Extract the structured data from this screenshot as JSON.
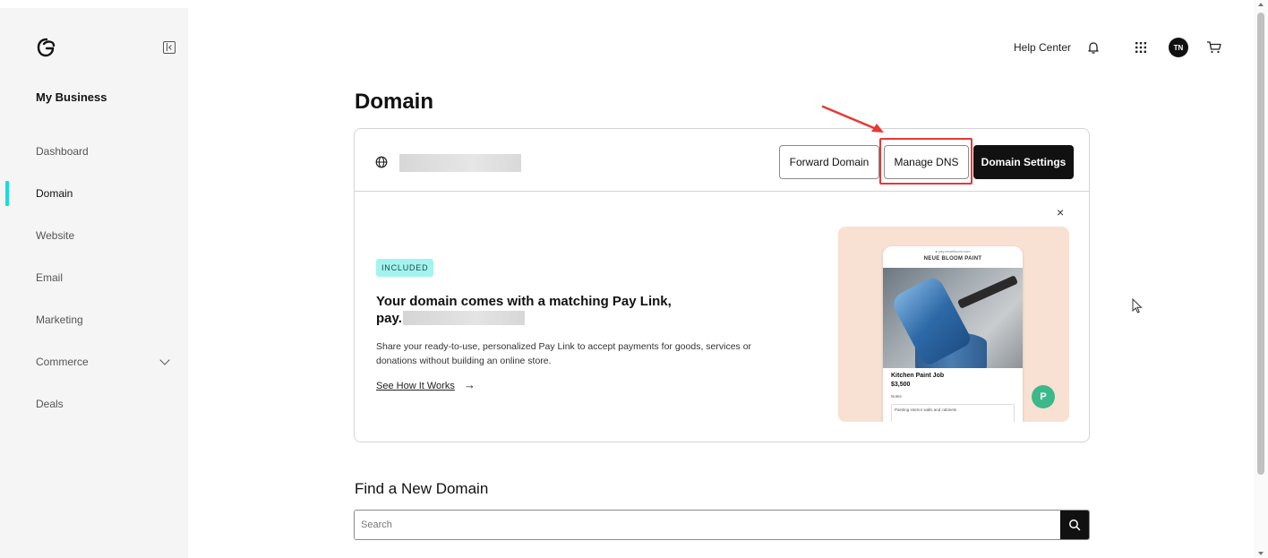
{
  "sidebar": {
    "brand": "My Business",
    "items": [
      {
        "label": "Dashboard"
      },
      {
        "label": "Domain"
      },
      {
        "label": "Website"
      },
      {
        "label": "Email"
      },
      {
        "label": "Marketing"
      },
      {
        "label": "Commerce"
      },
      {
        "label": "Deals"
      }
    ],
    "active_item": "Domain"
  },
  "header": {
    "help_center": "Help Center",
    "avatar_initials": "TN"
  },
  "main": {
    "title": "Domain",
    "domain_card": {
      "buttons": {
        "forward": "Forward Domain",
        "manage_dns": "Manage DNS",
        "settings": "Domain Settings"
      },
      "promo": {
        "badge": "INCLUDED",
        "title": "Your domain comes with a matching Pay Link,",
        "pay_prefix": "pay.",
        "description": "Share your ready-to-use, personalized Pay Link to accept payments for goods, services or donations without building an online store.",
        "link": "See How It Works",
        "close": "×",
        "arrow": "→"
      },
      "preview": {
        "url": "● pay.neuebloom.com",
        "brand": "NEUE BLOOM PAINT",
        "item": "Kitchen Paint Job",
        "price": "$3,500",
        "notes_label": "Notes",
        "notes_text": "Painting interior walls and cabinets",
        "avatar_letter": "P"
      }
    },
    "find_domain": {
      "title": "Find a New Domain",
      "placeholder": "Search"
    }
  },
  "colors": {
    "accent": "#1bdbdb",
    "badge_bg": "#a4f3ee",
    "highlight": "#e53935",
    "dark": "#111111"
  }
}
